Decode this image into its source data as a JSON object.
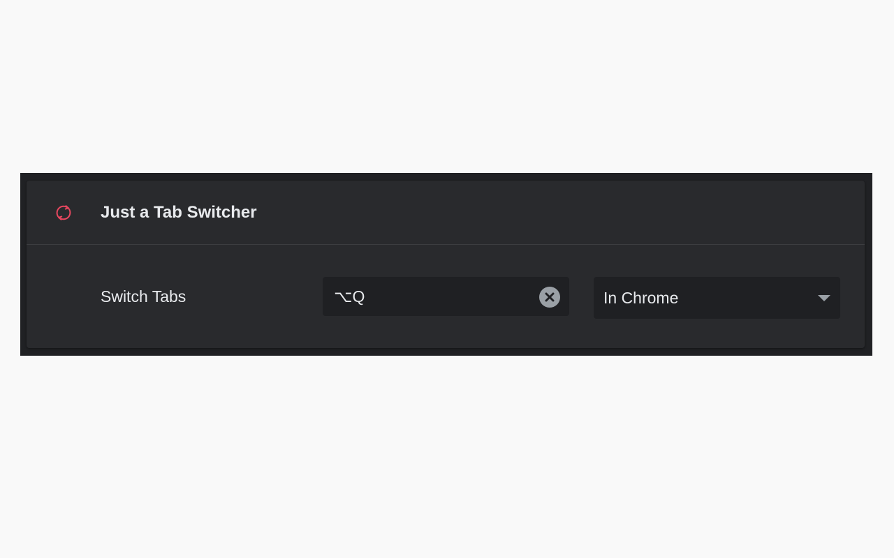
{
  "extension": {
    "name": "Just a Tab Switcher",
    "icon": "refresh-icon",
    "icon_color": "#e8475f"
  },
  "shortcut": {
    "label": "Switch Tabs",
    "value": "⌥Q",
    "clear_icon": "close-circle-icon",
    "scope": {
      "selected": "In Chrome",
      "icon": "dropdown-arrow-icon"
    }
  },
  "colors": {
    "page_background": "#f9f9f9",
    "panel_background": "#202124",
    "card_background": "#292a2d",
    "field_background": "#1f2023",
    "text": "#e8eaed"
  }
}
